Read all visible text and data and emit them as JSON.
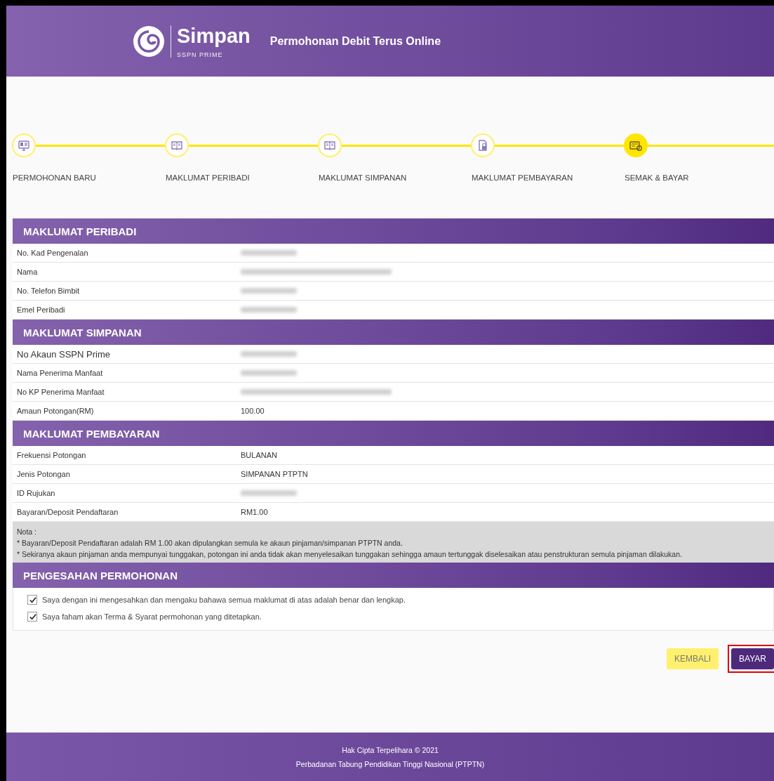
{
  "header": {
    "logo_title": "Simpan",
    "logo_subtitle": "SSPN PRIME",
    "title": "Permohonan Debit Terus Online"
  },
  "steps": [
    {
      "label": "PERMOHONAN BARU",
      "kind": "monitor",
      "selected": false
    },
    {
      "label": "MAKLUMAT PERIBADI",
      "kind": "book",
      "selected": false
    },
    {
      "label": "MAKLUMAT SIMPANAN",
      "kind": "book",
      "selected": false
    },
    {
      "label": "MAKLUMAT PEMBAYARAN",
      "kind": "document",
      "selected": false
    },
    {
      "label": "SEMAK & BAYAR",
      "kind": "card",
      "selected": true
    }
  ],
  "sections": [
    {
      "title": "MAKLUMAT PERIBADI",
      "rows": [
        {
          "label": "No. Kad Pengenalan",
          "kind": "redacted"
        },
        {
          "label": "Nama",
          "kind": "redacted_long"
        },
        {
          "label": "No. Telefon Bimbit",
          "kind": "redacted"
        },
        {
          "label": "Emel Peribadi",
          "kind": "redacted"
        }
      ]
    },
    {
      "title": "MAKLUMAT SIMPANAN",
      "rows": [
        {
          "label": "No Akaun SSPN Prime",
          "kind": "redacted",
          "large": true
        },
        {
          "label": "Nama Penerima Manfaat",
          "kind": "redacted"
        },
        {
          "label": "No KP Penerima Manfaat",
          "kind": "redacted_long"
        },
        {
          "label": "Amaun Potongan(RM)",
          "kind": "text",
          "value": "100.00"
        }
      ]
    },
    {
      "title": "MAKLUMAT PEMBAYARAN",
      "rows": [
        {
          "label": "Frekuensi Potongan",
          "kind": "text",
          "value": "BULANAN"
        },
        {
          "label": "Jenis Potongan",
          "kind": "text",
          "value": "SIMPANAN PTPTN"
        },
        {
          "label": "ID Rujukan",
          "kind": "redacted"
        },
        {
          "label": "Bayaran/Deposit Pendaftaran",
          "kind": "text",
          "value": "RM1.00"
        }
      ]
    }
  ],
  "note": {
    "title": "Nota :",
    "lines": [
      "* Bayaran/Deposit Pendaftaran adalah RM 1.00 akan dipulangkan semula ke akaun pinjaman/simpanan PTPTN anda.",
      "* Sekiranya akaun pinjaman anda mempunyai tunggakan, potongan ini anda tidak akan menyelesaikan tunggakan sehingga amaun tertunggak diselesaikan atau penstrukturan semula pinjaman dilakukan."
    ]
  },
  "confirmation": {
    "title": "PENGESAHAN PERMOHONAN",
    "items": [
      {
        "label": "Saya dengan ini mengesahkan dan mengaku bahawa semua maklumat di atas adalah benar dan lengkap.",
        "checked": true
      },
      {
        "label": "Saya faham akan Terma & Syarat permohonan yang ditetapkan.",
        "checked": true
      }
    ]
  },
  "buttons": [
    {
      "label": "KEMBALI",
      "kind": "secondary",
      "highlighted": false
    },
    {
      "label": "BAYAR",
      "kind": "primary",
      "highlighted": true
    }
  ],
  "footer": {
    "lines": [
      "Hak Cipta Terpelihara © 2021",
      "Perbadanan Tabung Pendidikan Tinggi Nasional (PTPTN)"
    ]
  }
}
